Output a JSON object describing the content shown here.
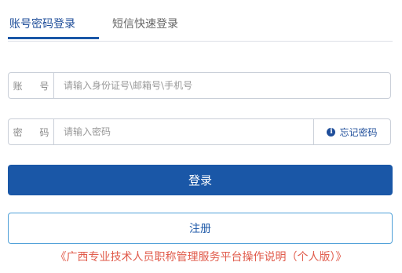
{
  "tabs": [
    {
      "label": "账号密码登录",
      "active": true
    },
    {
      "label": "短信快速登录",
      "active": false
    }
  ],
  "account": {
    "label": "账 号",
    "placeholder": "请输入身份证号\\邮箱号\\手机号",
    "value": ""
  },
  "password": {
    "label": "密 码",
    "placeholder": "请输入密码",
    "value": "",
    "forgot_label": "忘记密码",
    "forgot_icon": "info-icon"
  },
  "buttons": {
    "login": "登录",
    "register": "注册"
  },
  "manual_link": "《广西专业技术人员职称管理服务平台操作说明（个人版）》",
  "colors": {
    "primary": "#1a57a7",
    "register_border": "#4fa0d8",
    "link": "#e05a4a"
  }
}
